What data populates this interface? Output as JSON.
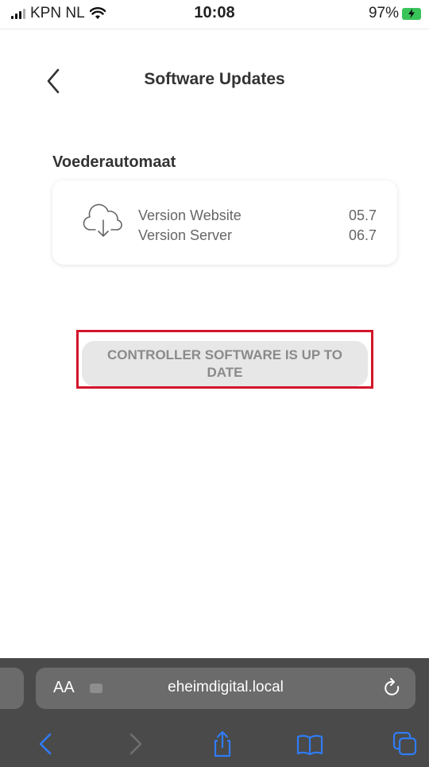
{
  "status_bar": {
    "carrier": "KPN NL",
    "time": "10:08",
    "battery": "97%"
  },
  "header": {
    "title": "Software Updates"
  },
  "section": {
    "title": "Voederautomaat",
    "rows": [
      {
        "label": "Version Website",
        "value": "05.7"
      },
      {
        "label": "Version Server",
        "value": "06.7"
      }
    ]
  },
  "banner": {
    "text": "CONTROLLER SOFTWARE IS UP TO DATE",
    "highlight_color": "#d3152a"
  },
  "browser": {
    "text_size_label": "AA",
    "url": "eheimdigital.local"
  },
  "colors": {
    "accent_blue": "#2f7cf6",
    "battery_green": "#39c45a",
    "safari_bar": "#4a4a4a"
  }
}
